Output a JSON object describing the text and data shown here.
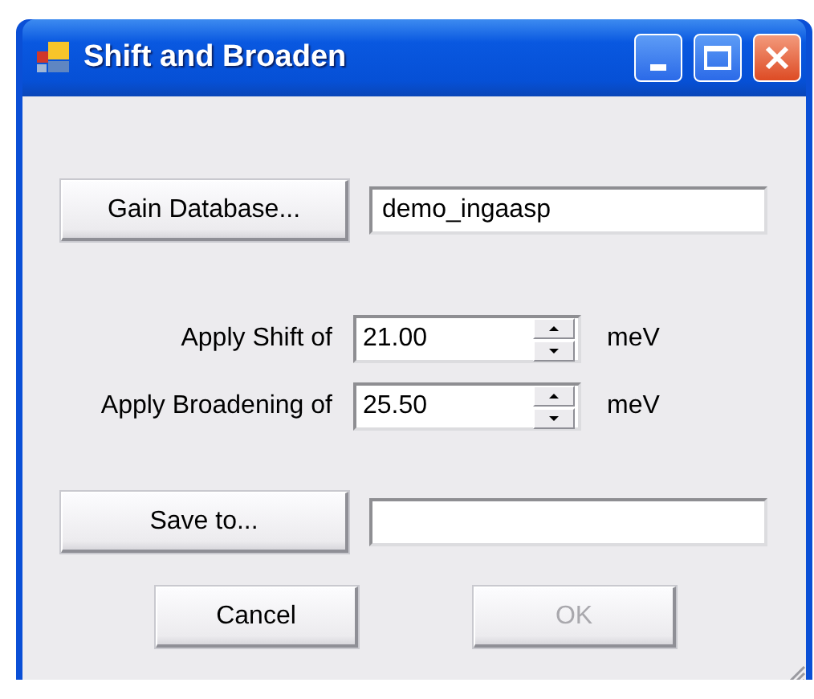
{
  "window": {
    "title": "Shift and Broaden"
  },
  "gain_database": {
    "button": "Gain Database...",
    "value": "demo_ingaasp"
  },
  "parameters": [
    {
      "label": "Apply Shift of",
      "value": "21.00",
      "unit": "meV"
    },
    {
      "label": "Apply Broadening of",
      "value": "25.50",
      "unit": "meV"
    }
  ],
  "save_to": {
    "button": "Save to..."
  },
  "buttons": [
    {
      "label": "Cancel",
      "disabled": false
    },
    {
      "label": "OK",
      "disabled": true
    }
  ]
}
